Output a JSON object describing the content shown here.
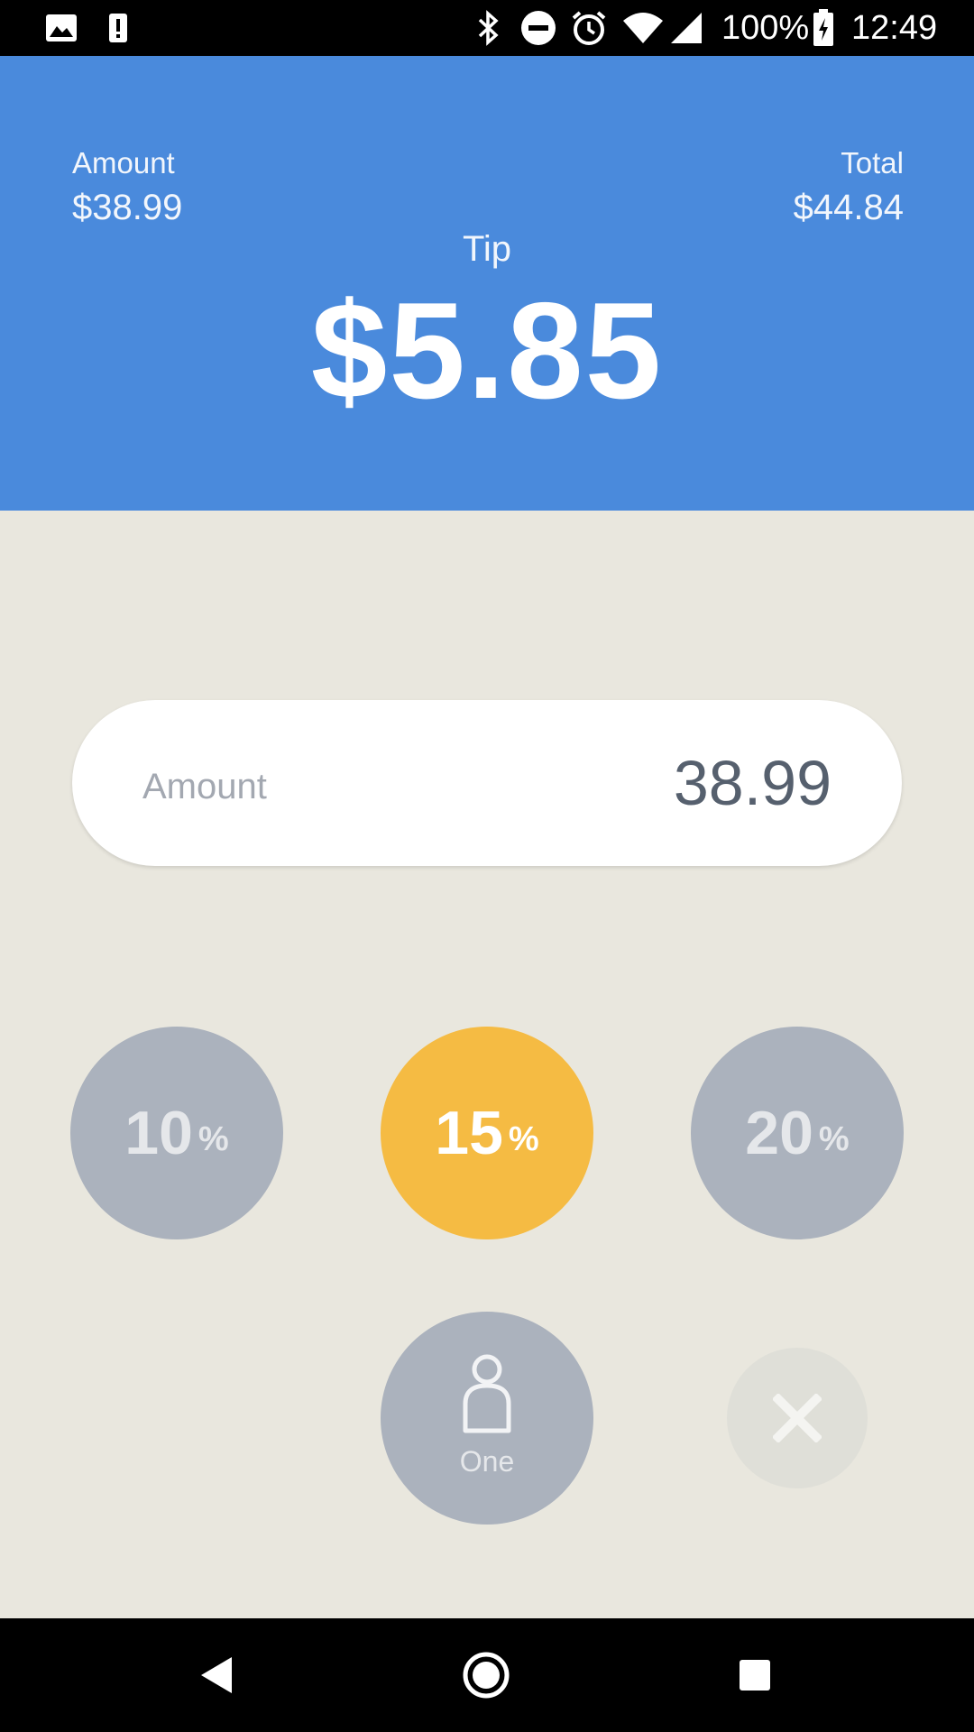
{
  "status_bar": {
    "battery_percent": "100%",
    "time": "12:49",
    "icons": [
      "image-icon",
      "sim-alert-icon",
      "bluetooth-icon",
      "do-not-disturb-icon",
      "alarm-icon",
      "wifi-icon",
      "signal-icon",
      "battery-charging-icon"
    ]
  },
  "header": {
    "amount_label": "Amount",
    "amount_value": "$38.99",
    "total_label": "Total",
    "total_value": "$44.84",
    "tip_label": "Tip",
    "tip_value": "$5.85"
  },
  "amount_input": {
    "label": "Amount",
    "value": "38.99"
  },
  "tip_options": [
    {
      "value": "10",
      "unit": "%",
      "selected": false
    },
    {
      "value": "15",
      "unit": "%",
      "selected": true
    },
    {
      "value": "20",
      "unit": "%",
      "selected": false
    }
  ],
  "split": {
    "label": "One",
    "icon": "person-icon"
  },
  "clear": {
    "icon": "close-icon"
  },
  "nav_bar": {
    "icons": [
      "back-icon",
      "home-icon",
      "recents-icon"
    ]
  },
  "colors": {
    "header": "#4a8adc",
    "background": "#e9e7de",
    "selected": "#f5bb43",
    "unselected": "#abb2bd"
  }
}
